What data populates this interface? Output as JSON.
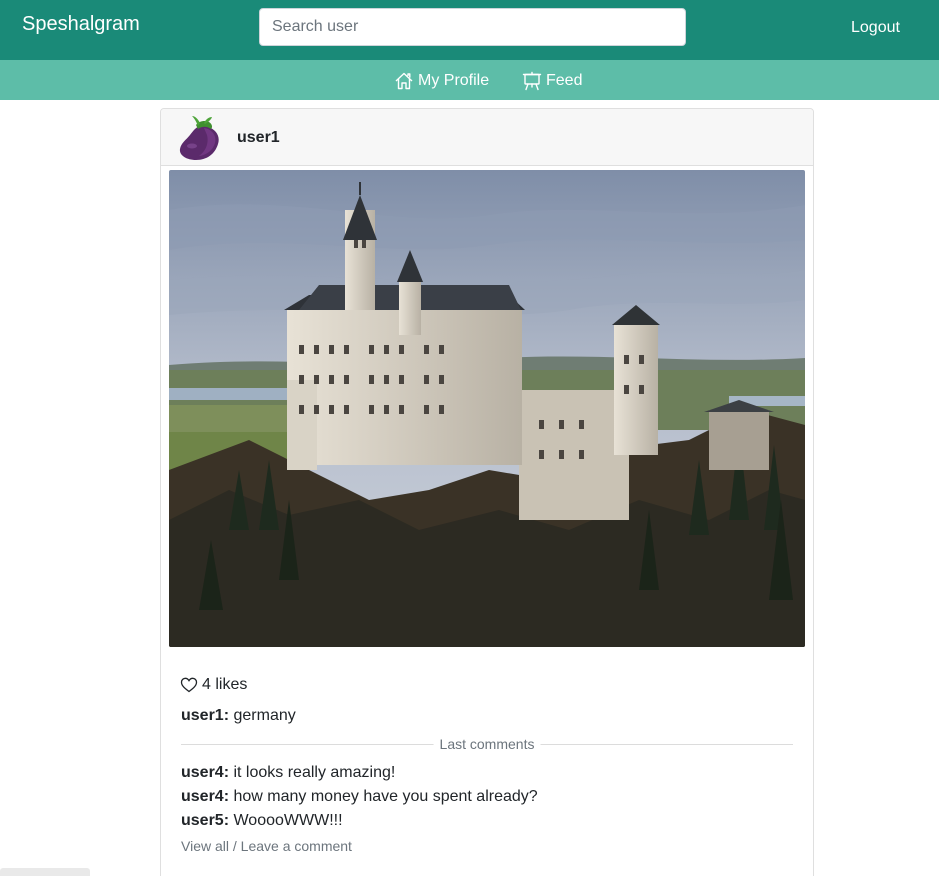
{
  "navbar": {
    "brand": "Speshalgram",
    "search_placeholder": "Search user",
    "logout": "Logout",
    "colors": {
      "primary": "#1a8a78",
      "secondary": "#5dbda8"
    }
  },
  "subnav": {
    "items": [
      {
        "label": "My Profile",
        "icon": "home-icon"
      },
      {
        "label": "Feed",
        "icon": "easel-icon"
      }
    ]
  },
  "post": {
    "author": "user1",
    "avatar_icon": "eggplant-icon",
    "image_subject": "castle-photo",
    "likes_count": 4,
    "likes_text": "4 likes",
    "caption": {
      "user": "user1:",
      "text": "germany"
    },
    "comments_divider": "Last comments",
    "comments": [
      {
        "user": "user4:",
        "text": "it looks really amazing!"
      },
      {
        "user": "user4:",
        "text": "how many money have you spent already?"
      },
      {
        "user": "user5:",
        "text": "WooooWWW!!!"
      }
    ],
    "view_all": "View all / Leave a comment"
  }
}
